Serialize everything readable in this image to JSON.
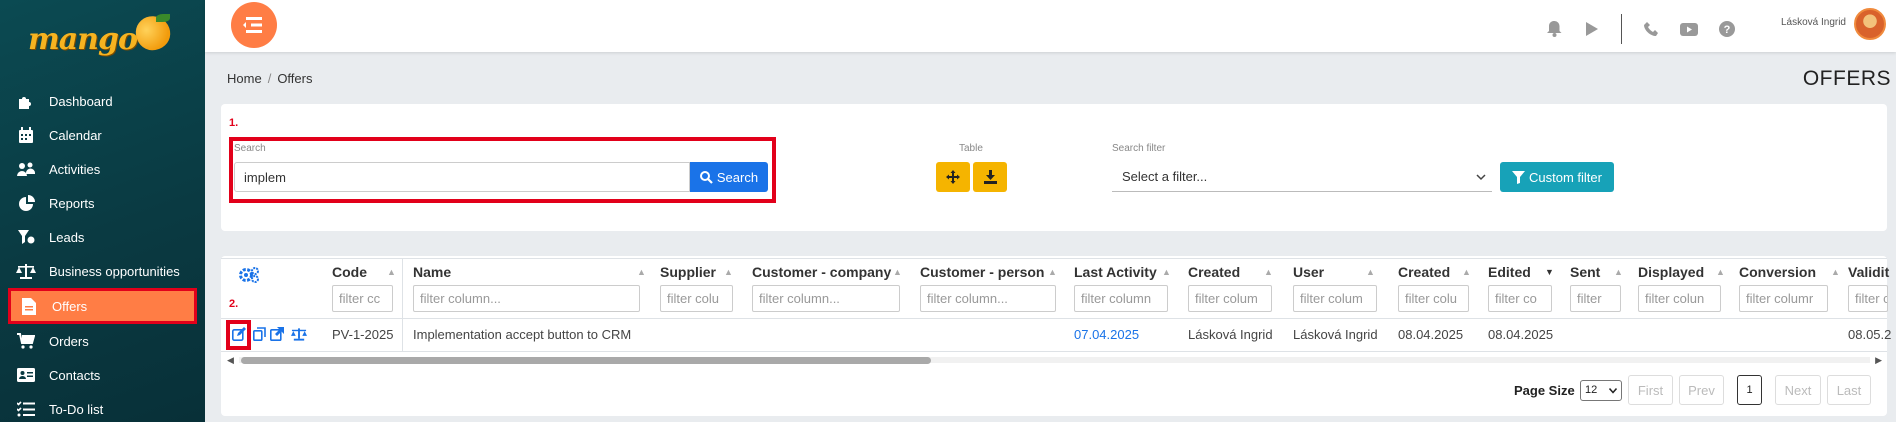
{
  "app": {
    "brand": "mango"
  },
  "sidebar": {
    "items": [
      {
        "label": "Dashboard",
        "icon": "puzzle-icon"
      },
      {
        "label": "Calendar",
        "icon": "calendar-icon"
      },
      {
        "label": "Activities",
        "icon": "activities-icon"
      },
      {
        "label": "Reports",
        "icon": "pie-chart-icon"
      },
      {
        "label": "Leads",
        "icon": "leads-icon"
      },
      {
        "label": "Business opportunities",
        "icon": "balance-scale-icon"
      },
      {
        "label": "Offers",
        "icon": "document-icon",
        "active": true
      },
      {
        "label": "Orders",
        "icon": "cart-icon"
      },
      {
        "label": "Contacts",
        "icon": "address-card-icon"
      },
      {
        "label": "To-Do list",
        "icon": "checklist-icon"
      }
    ]
  },
  "topbar": {
    "user_name": "Lásková Ingrid",
    "icons": [
      "bell-icon",
      "play-icon",
      "phone-icon",
      "youtube-icon",
      "help-icon"
    ]
  },
  "breadcrumb": {
    "home": "Home",
    "sep": "/",
    "current": "Offers"
  },
  "page_title": "OFFERS",
  "markers": {
    "one": "1.",
    "two": "2."
  },
  "filters": {
    "search_label": "Search",
    "search_value": "implem",
    "search_button": "Search",
    "table_label": "Table",
    "search_filter_label": "Search filter",
    "search_filter_placeholder": "Select a filter...",
    "custom_filter_button": "Custom filter"
  },
  "table": {
    "columns": [
      "Code",
      "Name",
      "Supplier",
      "Customer - company",
      "Customer - person",
      "Last Activity",
      "Created",
      "User",
      "Created",
      "Edited",
      "Sent",
      "Displayed",
      "Conversion",
      "Validit"
    ],
    "filter_placeholders": [
      "filter cc",
      "filter column...",
      "filter colu",
      "filter column...",
      "filter column...",
      "filter column",
      "filter colum",
      "filter colum",
      "filter colu",
      "filter co",
      "filter",
      "filter colun",
      "filter columr",
      "filter c"
    ],
    "rows": [
      {
        "code": "PV-1-2025",
        "name": "Implementation accept button to CRM",
        "supplier": "",
        "customer_company": "",
        "customer_person": "",
        "last_activity": "07.04.2025",
        "created_by": "Lásková Ingrid",
        "user": "Lásková Ingrid",
        "created": "08.04.2025",
        "edited": "08.04.2025",
        "sent": "",
        "displayed": "",
        "conversion": "",
        "validity": "08.05.2"
      }
    ]
  },
  "pagination": {
    "page_size_label": "Page Size",
    "page_size_value": "12",
    "first": "First",
    "prev": "Prev",
    "current": "1",
    "next": "Next",
    "last": "Last"
  }
}
